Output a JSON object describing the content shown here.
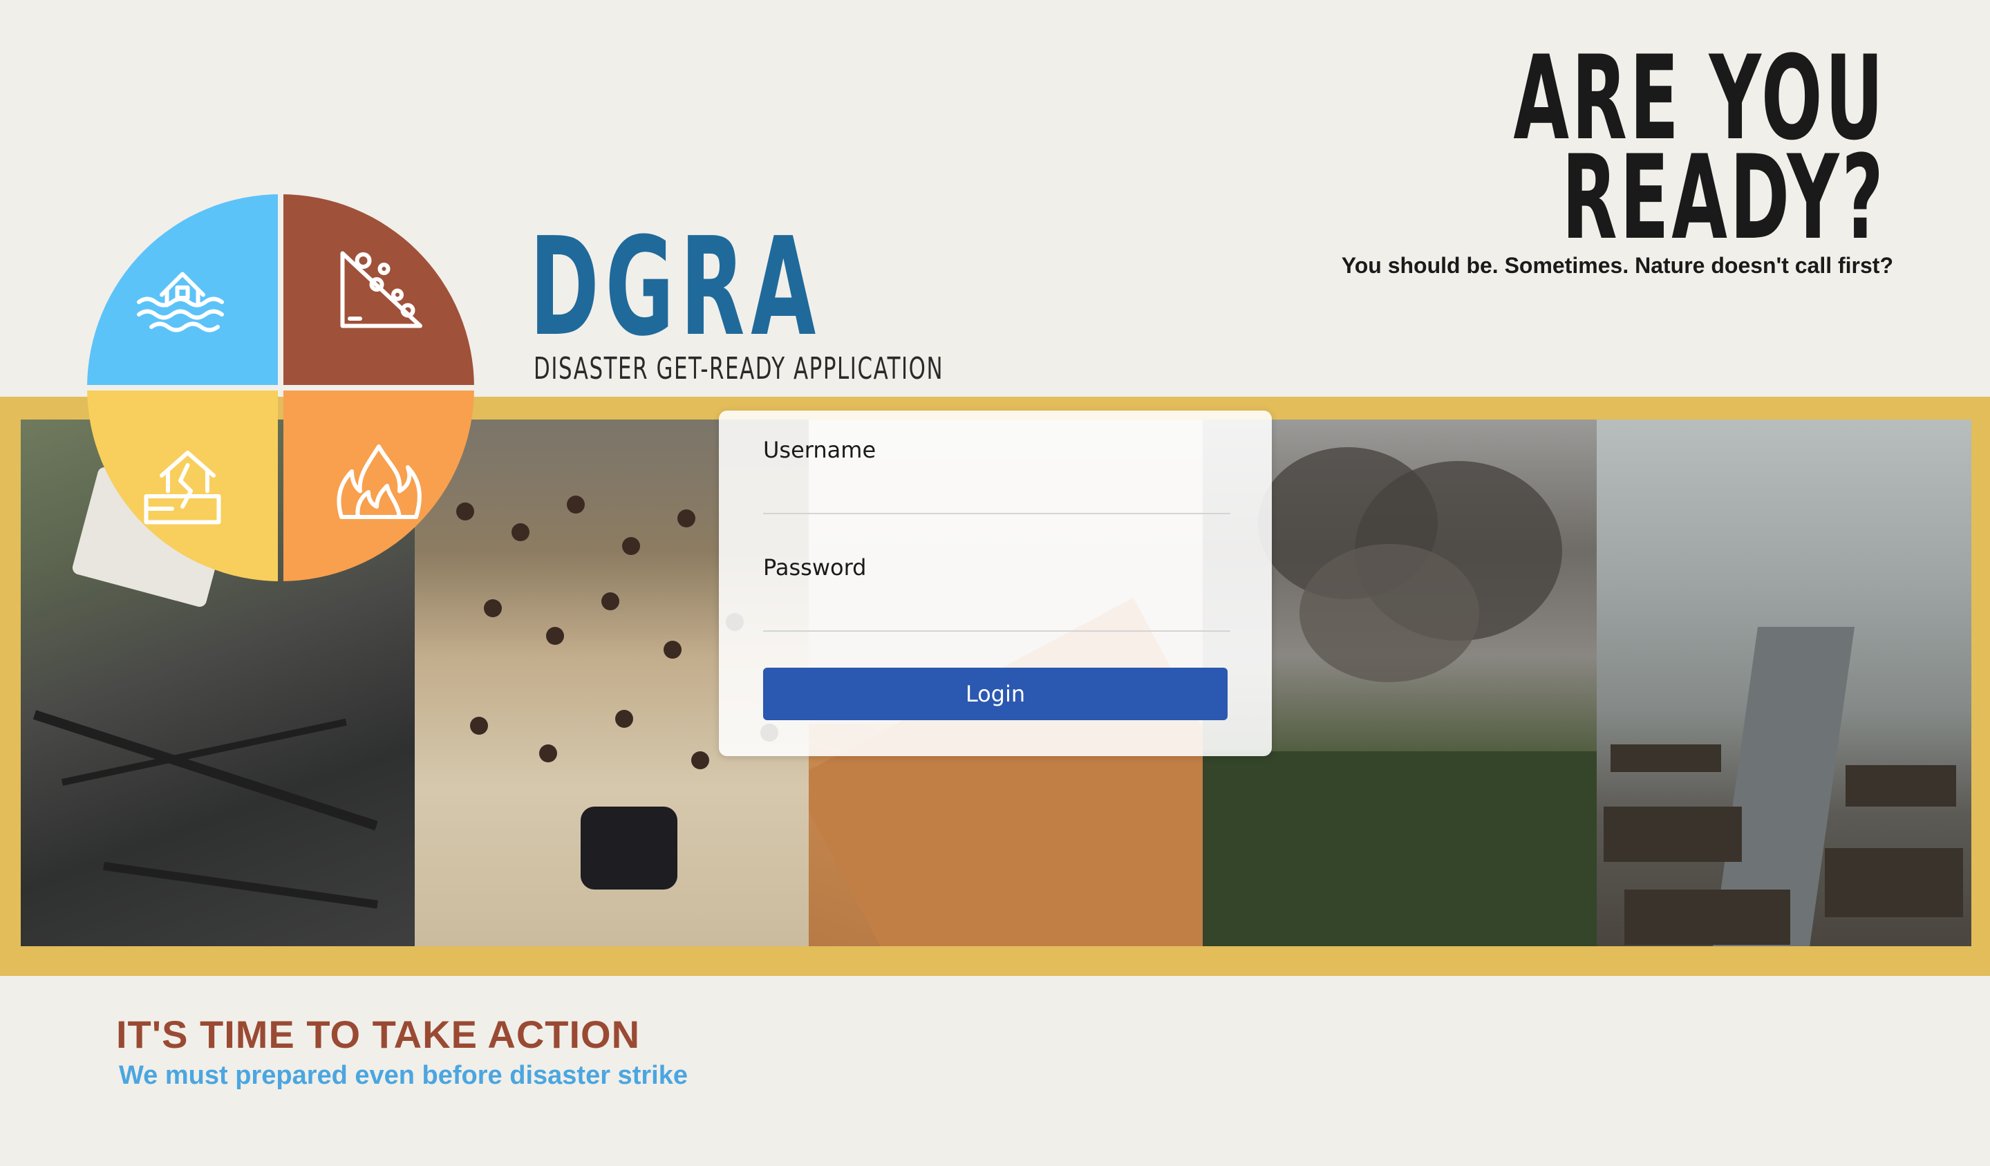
{
  "brand": {
    "title": "DGRA",
    "subtitle": "DISASTER GET-READY APPLICATION",
    "color": "#1f6a9a"
  },
  "headline": {
    "line1": "ARE YOU",
    "line2": "READY?",
    "tagline": "You should be. Sometimes. Nature doesn't call first?"
  },
  "logo": {
    "quadrants": [
      {
        "icon": "flood-house-icon",
        "color": "#5cc3f8"
      },
      {
        "icon": "landslide-icon",
        "color": "#a0513a"
      },
      {
        "icon": "earthquake-house-icon",
        "color": "#f8cf5c"
      },
      {
        "icon": "fire-icon",
        "color": "#f8a04e"
      }
    ]
  },
  "photos": [
    {
      "subject": "earthquake"
    },
    {
      "subject": "flood"
    },
    {
      "subject": "landslide"
    },
    {
      "subject": "volcano"
    },
    {
      "subject": "typhoon"
    }
  ],
  "login": {
    "username_label": "Username",
    "username_value": "",
    "password_label": "Password",
    "password_value": "",
    "button_label": "Login",
    "button_color": "#2b58b0"
  },
  "footer": {
    "action_title": "IT'S TIME TO TAKE ACTION",
    "action_subtitle": "We must prepared even before disaster strike",
    "title_color": "#9a4a33",
    "subtitle_color": "#4aa6e0"
  },
  "colors": {
    "background": "#f1efea",
    "banner": "#e2bd5a"
  }
}
